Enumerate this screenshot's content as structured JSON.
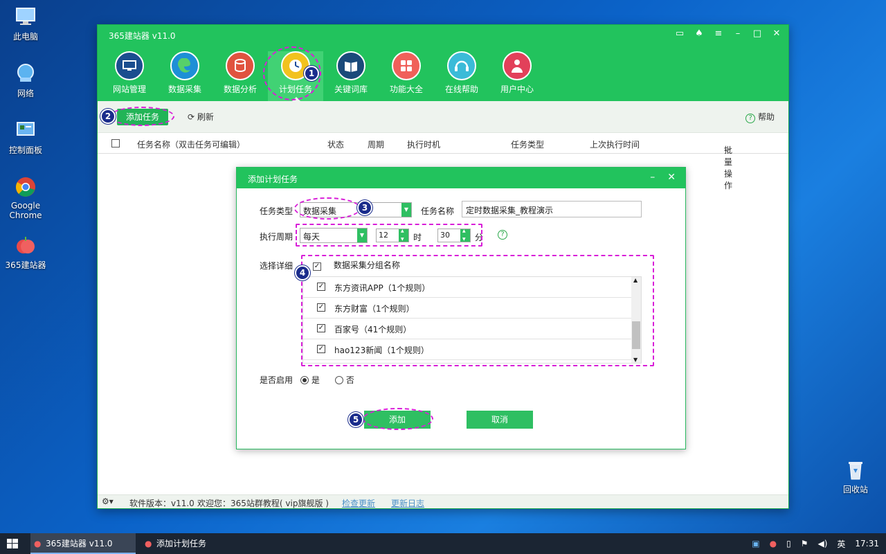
{
  "desktop": {
    "icons": [
      {
        "label": "此电脑"
      },
      {
        "label": "网络"
      },
      {
        "label": "控制面板"
      },
      {
        "label": "Google Chrome"
      },
      {
        "label": "365建站器"
      },
      {
        "label": "回收站"
      }
    ]
  },
  "app": {
    "title": "365建站器 v11.0",
    "nav": [
      {
        "label": "网站管理",
        "color": "#1b4e8f"
      },
      {
        "label": "数据采集",
        "color": "#1e8fd6"
      },
      {
        "label": "数据分析",
        "color": "#e0533f"
      },
      {
        "label": "计划任务",
        "color": "#f2c21e"
      },
      {
        "label": "关键词库",
        "color": "#1a4a7a"
      },
      {
        "label": "功能大全",
        "color": "#f0605a"
      },
      {
        "label": "在线帮助",
        "color": "#3bbbd8"
      },
      {
        "label": "用户中心",
        "color": "#e2405a"
      }
    ],
    "toolbar": {
      "add_label": "添加任务",
      "refresh_label": "刷新",
      "help_label": "帮助"
    },
    "table_headers": {
      "name": "任务名称（双击任务可编辑）",
      "status": "状态",
      "cycle": "周期",
      "exec_time": "执行时机",
      "type": "任务类型",
      "last_time": "上次执行时间",
      "batch": "批量操作"
    },
    "statusbar": {
      "version": "软件版本：v11.0",
      "welcome": "欢迎您：365站群教程( vip旗舰版 )",
      "check_update": "检查更新",
      "changelog": "更新日志"
    }
  },
  "dialog": {
    "title": "添加计划任务",
    "task_type_label": "任务类型",
    "task_type_value": "数据采集",
    "task_name_label": "任务名称",
    "task_name_value": "定时数据采集_教程演示",
    "cycle_label": "执行周期",
    "cycle_value": "每天",
    "hour_value": "12",
    "hour_unit": "时",
    "minute_value": "30",
    "minute_unit": "分",
    "detail_label": "选择详细",
    "group_header": "数据采集分组名称",
    "groups": [
      {
        "label": "东方资讯APP（1个规则）",
        "checked": true
      },
      {
        "label": "东方财富（1个规则）",
        "checked": true
      },
      {
        "label": "百家号（41个规则）",
        "checked": true
      },
      {
        "label": "hao123新闻（1个规则）",
        "checked": true
      }
    ],
    "enable_label": "是否启用",
    "enable_yes": "是",
    "enable_no": "否",
    "enable_selected": "是",
    "add_button": "添加",
    "cancel_button": "取消"
  },
  "annotations": [
    "1",
    "2",
    "3",
    "4",
    "5"
  ],
  "taskbar": {
    "items": [
      {
        "label": "365建站器 v11.0"
      },
      {
        "label": "添加计划任务"
      }
    ],
    "ime": "英",
    "time": "17:31"
  }
}
